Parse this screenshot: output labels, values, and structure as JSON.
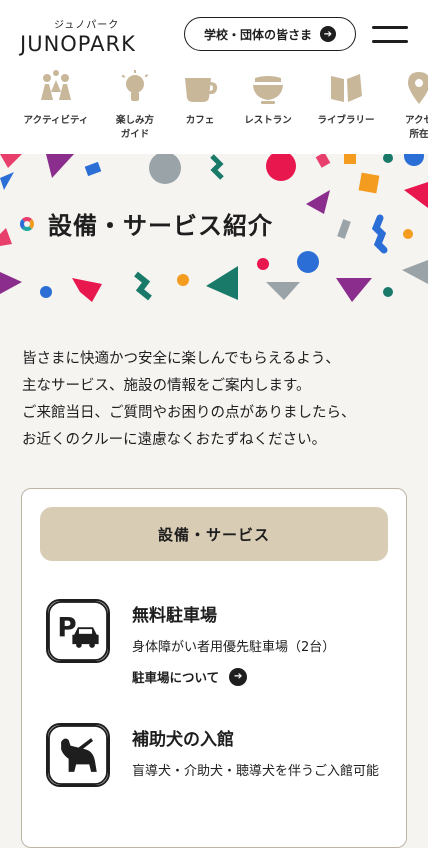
{
  "header": {
    "logo_kana": "ジュノパーク",
    "logo_main": "JUNOPARK",
    "school_button": "学校・団体の皆さま",
    "arrow": "➔"
  },
  "nav": [
    {
      "label": "アクティビティ",
      "icon": "people-icon"
    },
    {
      "label": "楽しみ方\nガイド",
      "icon": "lightbulb-icon"
    },
    {
      "label": "カフェ",
      "icon": "coffee-cup-icon"
    },
    {
      "label": "レストラン",
      "icon": "bowl-icon"
    },
    {
      "label": "ライブラリー",
      "icon": "book-icon"
    },
    {
      "label": "アクセ\n所在",
      "icon": "map-pin-icon"
    }
  ],
  "hero": {
    "title": "設備・サービス紹介"
  },
  "intro": [
    "皆さまに快適かつ安全に楽しんでもらえるよう、",
    "主なサービス、施設の情報をご案内します。",
    "ご来館当日、ご質問やお困りの点がありましたら、",
    "お近くのクルーに遠慮なくおたずねください。"
  ],
  "card": {
    "heading": "設備・サービス",
    "services": [
      {
        "title": "無料駐車場",
        "description": "身体障がい者用優先駐車場（2台）",
        "link": "駐車場について",
        "icon": "parking-icon"
      },
      {
        "title": "補助犬の入館",
        "description": "盲導犬・介助犬・聴導犬を伴うご入館可能",
        "icon": "guide-dog-icon"
      }
    ]
  },
  "colors": {
    "accent_beige": "#d8ccb4",
    "text": "#1e1e1e",
    "background": "#f6f4f1"
  }
}
